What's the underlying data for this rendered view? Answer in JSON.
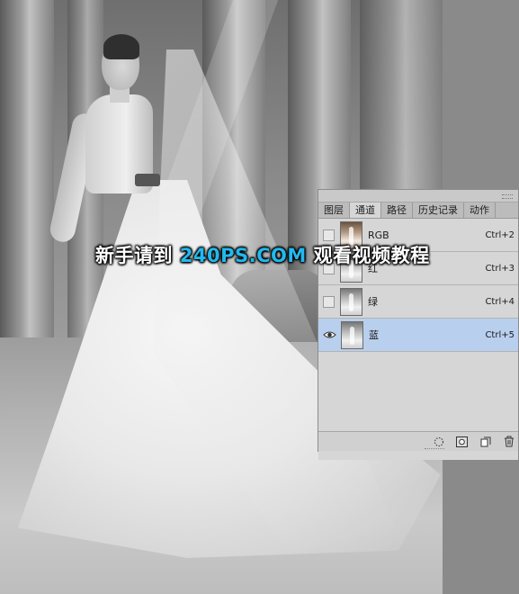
{
  "watermark": {
    "prefix": "新手请到 ",
    "brand": "240PS.COM",
    "suffix": " 观看视频教程"
  },
  "panel": {
    "tabs": [
      {
        "label": "图层",
        "active": false
      },
      {
        "label": "通道",
        "active": true
      },
      {
        "label": "路径",
        "active": false
      },
      {
        "label": "历史记录",
        "active": false
      },
      {
        "label": "动作",
        "active": false
      }
    ],
    "channels": [
      {
        "name": "RGB",
        "shortcut": "Ctrl+2",
        "visible": false,
        "selected": false,
        "thumb": "color"
      },
      {
        "name": "红",
        "shortcut": "Ctrl+3",
        "visible": false,
        "selected": false,
        "thumb": "gray"
      },
      {
        "name": "绿",
        "shortcut": "Ctrl+4",
        "visible": false,
        "selected": false,
        "thumb": "gray"
      },
      {
        "name": "蓝",
        "shortcut": "Ctrl+5",
        "visible": true,
        "selected": true,
        "thumb": "gray"
      }
    ],
    "footer_icons": [
      "load-selection-icon",
      "save-selection-icon",
      "new-channel-icon",
      "delete-channel-icon"
    ]
  },
  "colors": {
    "selected_row": "#b9cfee",
    "watermark_brand": "#21b9ee"
  }
}
